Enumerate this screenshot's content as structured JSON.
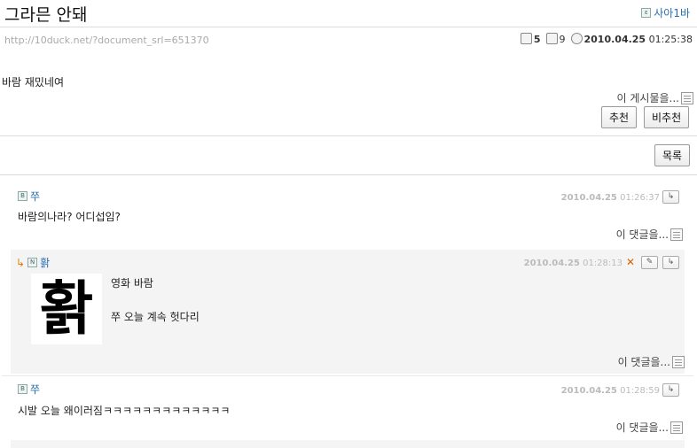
{
  "post": {
    "title": "그라믄 안돼",
    "author": "사아1바",
    "url": "http://10duck.net/?document_srl=651370",
    "comment_count": "5",
    "read_count": "9",
    "date": "2010.04.25",
    "time": "01:25:38",
    "body": "바람 재밌네여",
    "this_post_menu": "이 게시물을...",
    "recommend_label": "추천",
    "not_recommend_label": "비추천",
    "list_label": "목록"
  },
  "comments": [
    {
      "author": "쭈",
      "date": "2010.04.25",
      "time": "01:26:37",
      "text": "바람의나라? 어디섭임?",
      "menu": "이 댓글을..."
    },
    {
      "author": "홝",
      "date": "2010.04.25",
      "time": "01:28:13",
      "image_glyph": "홝",
      "line1": "영화 바람",
      "line2": "쭈 오늘 계속 헛다리",
      "menu": "이 댓글을..."
    },
    {
      "author": "쭈",
      "date": "2010.04.25",
      "time": "01:28:59",
      "text": "시발 오늘 왜이러짐ㅋㅋㅋㅋㅋㅋㅋㅋㅋㅋㅋㅋㅋ",
      "menu": "이 댓글을..."
    }
  ],
  "colors": {
    "link": "#2a6fb0",
    "reply_bg": "#f4f4f4",
    "date": "#bbbbbb",
    "delete": "#e06000"
  }
}
